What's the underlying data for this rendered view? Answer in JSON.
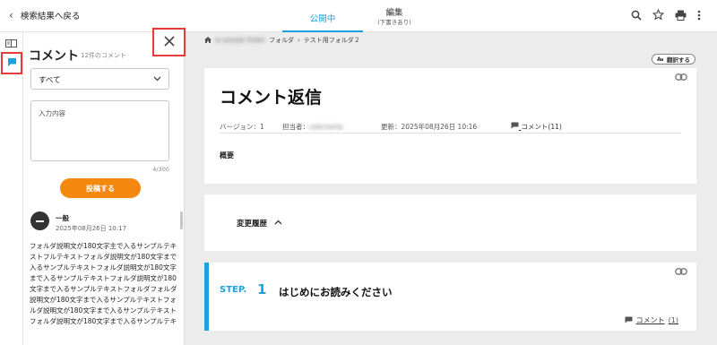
{
  "topbar": {
    "back_label": "検索結果へ戻る",
    "tab_public": "公開中",
    "tab_edit": "編集",
    "tab_edit_sub": "(下書きあり)"
  },
  "comment_panel": {
    "title": "コメント",
    "count": "12件のコメント",
    "filter_value": "すべて",
    "input_placeholder": "入力内容",
    "char_counter": "4/300",
    "post_button": "投稿する",
    "comment": {
      "author": "一般",
      "date": "2025年08月26日 10:17",
      "body": "フォルダ説明文が180文字主で入るサンプルテキストフルテキストフォルダ説明文が180文字まで入るサンプルテキストフォルダ説明文が180文字まで入るサンプルテキストフォルダ説明文が180文字まで入るサンプルテキストフォルダフォルダ説明文が180文字まで入るサンプルテキストフォルダ説明文が180文字まで入るサンプルテキストフォルダ説明文が180文字まで入るサンプルテキ"
    }
  },
  "breadcrumb": {
    "blurred": "w sample folder",
    "item1": "フォルダ",
    "item2": "テスト用フォルダ２"
  },
  "translate_label": "翻訳する",
  "document": {
    "title": "コメント返信",
    "version": "バージョン：1",
    "owner_label": "担当者：",
    "owner_value": "username",
    "updated": "更新：2025年08月26日 10:16",
    "comments_link": "コメント(11)",
    "overview_label": "概要"
  },
  "history_label": "変更履歴",
  "step": {
    "label": "STEP.",
    "number": "1",
    "title": "はじめにお読みください",
    "comment_label": "コメント",
    "comment_count": "(1)"
  },
  "colors": {
    "accent": "#1da1dc",
    "orange": "#f5880f",
    "highlight": "#e93a3a"
  }
}
